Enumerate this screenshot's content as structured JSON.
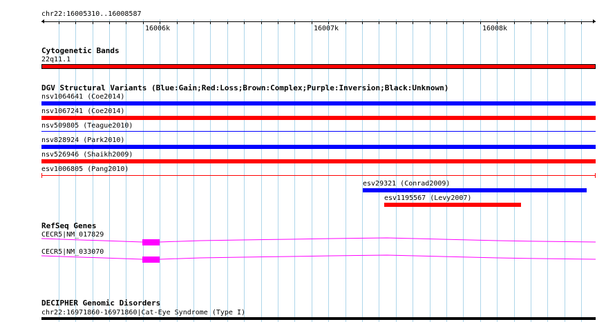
{
  "ruler": {
    "locus": "chr22:16005310..16008587",
    "ticks": [
      "16006k",
      "16007k",
      "16008k"
    ]
  },
  "tracks": {
    "cytoband": {
      "title": "Cytogenetic Bands",
      "band_label": "22q11.1",
      "color": "#ff0000"
    },
    "dgv": {
      "title": "DGV Structural Variants (Blue:Gain;Red:Loss;Brown:Complex;Purple:Inversion;Black:Unknown)",
      "variants": [
        {
          "label": "nsv1064641 (Coe2014)",
          "color": "#0000ff"
        },
        {
          "label": "nsv1067241 (Coe2014)",
          "color": "#ff0000"
        },
        {
          "label": "nsv509805 (Teague2010)",
          "color": "#0000ff"
        },
        {
          "label": "nsv828924 (Park2010)",
          "color": "#0000ff"
        },
        {
          "label": "nsv526946 (Shaikh2009)",
          "color": "#ff0000"
        },
        {
          "label": "esv1006805 (Pang2010)",
          "color": "#ff0000"
        },
        {
          "label": "esv29321 (Conrad2009)",
          "color": "#0000ff"
        },
        {
          "label": "esv1195567 (Levy2007)",
          "color": "#ff0000"
        }
      ]
    },
    "refseq": {
      "title": "RefSeq Genes",
      "genes": [
        {
          "label": "CECR5|NM_017829",
          "color": "#ff00ff"
        },
        {
          "label": "CECR5|NM_033070",
          "color": "#ff00ff"
        }
      ]
    },
    "decipher": {
      "title": "DECIPHER Genomic Disorders",
      "label": "chr22:16971860-16971860|Cat-Eye Syndrome (Type I)",
      "color": "#000000"
    }
  }
}
